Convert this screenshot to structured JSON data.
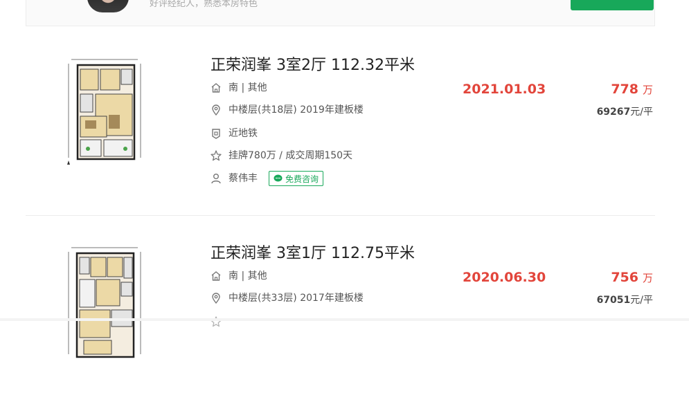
{
  "agent_card": {
    "tagline": "好评经纪人，熟悉本房特色",
    "accent": "#18a85a"
  },
  "listings": [
    {
      "title": "正荣润峯 3室2厅 112.32平米",
      "orientation": "南 | 其他",
      "floor": "中楼层(共18层) 2019年建板楼",
      "tag": "近地铁",
      "deal": "挂牌780万 / 成交周期150天",
      "agent": "蔡伟丰",
      "consult_label": "免费咨询",
      "deal_date": "2021.01.03",
      "total_price": "778",
      "total_unit": "万",
      "unit_price": "69267",
      "unit_price_suffix": "元/平"
    },
    {
      "title": "正荣润峯 3室1厅 112.75平米",
      "orientation": "南 | 其他",
      "floor": "中楼层(共33层) 2017年建板楼",
      "deal_date": "2020.06.30",
      "total_price": "756",
      "total_unit": "万",
      "unit_price": "67051",
      "unit_price_suffix": "元/平"
    }
  ],
  "colors": {
    "price_red": "#e2453b",
    "green": "#18a85a",
    "icon_gray": "#777777"
  },
  "icons": [
    "house-icon",
    "location-pin-icon",
    "subway-tag-icon",
    "star-icon",
    "person-icon",
    "chat-bubble-icon"
  ]
}
